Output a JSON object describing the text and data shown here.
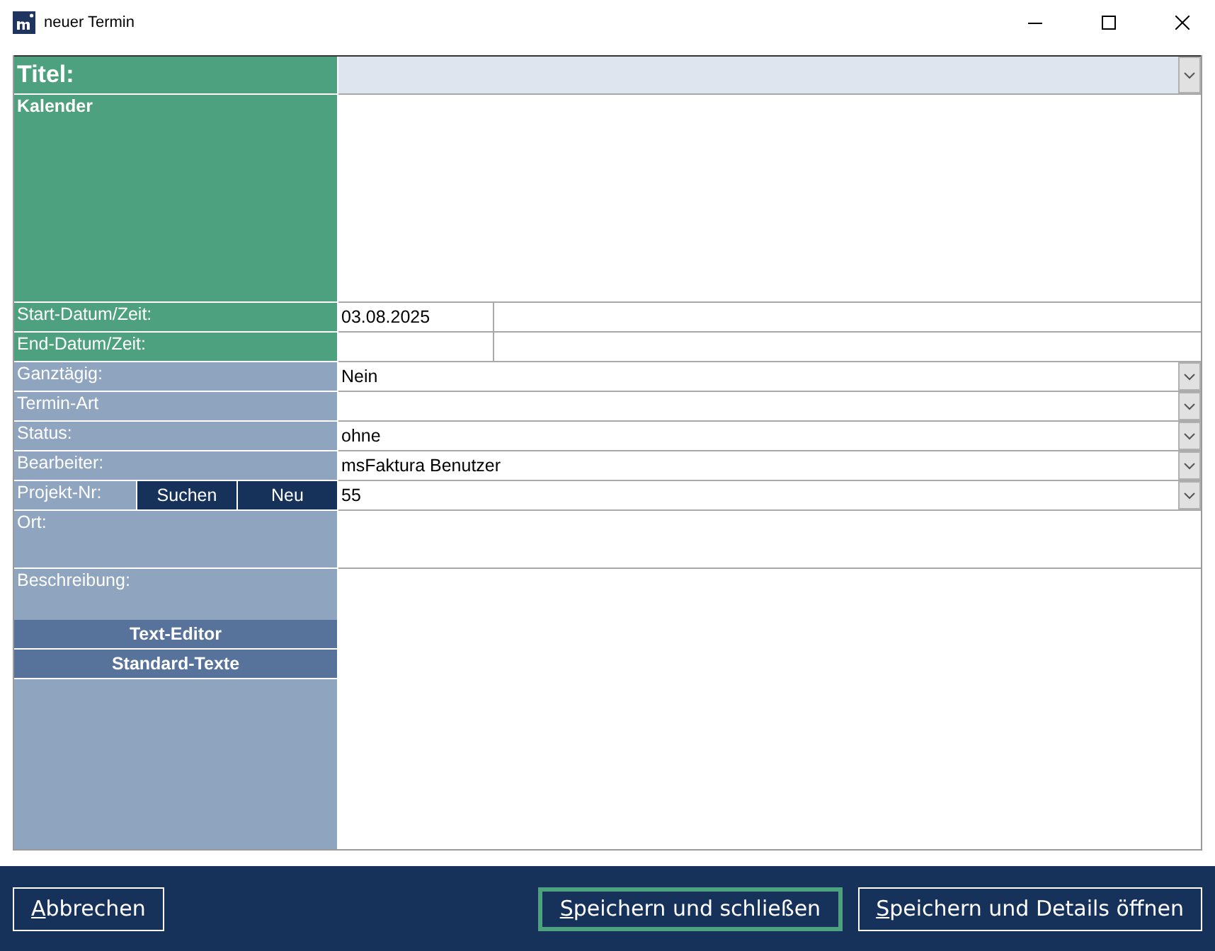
{
  "window": {
    "title": "neuer Termin"
  },
  "form": {
    "title_field": {
      "label": "Titel:"
    },
    "calendar": {
      "label": "Kalender"
    },
    "rows": [
      {
        "kind": "datetime",
        "label": "Start-Datum/Zeit:",
        "date": "03.08.2025"
      },
      {
        "kind": "datetime",
        "label": "End-Datum/Zeit:"
      },
      {
        "kind": "dropdown",
        "label": "Ganztägig:",
        "value": "Nein"
      },
      {
        "kind": "dropdown",
        "label": "Termin-Art"
      },
      {
        "kind": "dropdown",
        "label": "Status:",
        "value": "ohne"
      },
      {
        "kind": "dropdown",
        "label": "Bearbeiter:",
        "value": "msFaktura Benutzer"
      },
      {
        "kind": "dropdown",
        "label": "Projekt-Nr:",
        "value": "55",
        "buttons": [
          "Suchen",
          "Neu"
        ]
      },
      {
        "kind": "text",
        "label": "Ort:"
      }
    ],
    "description": {
      "label": "Beschreibung:",
      "buttons": [
        "Text-Editor",
        "Standard-Texte"
      ]
    }
  },
  "footer": {
    "buttons": [
      {
        "label": "Abbrechen",
        "focused": false
      },
      {
        "label": "Speichern und schließen",
        "focused": true
      },
      {
        "label": "Speichern und Details öffnen",
        "focused": false
      }
    ]
  }
}
